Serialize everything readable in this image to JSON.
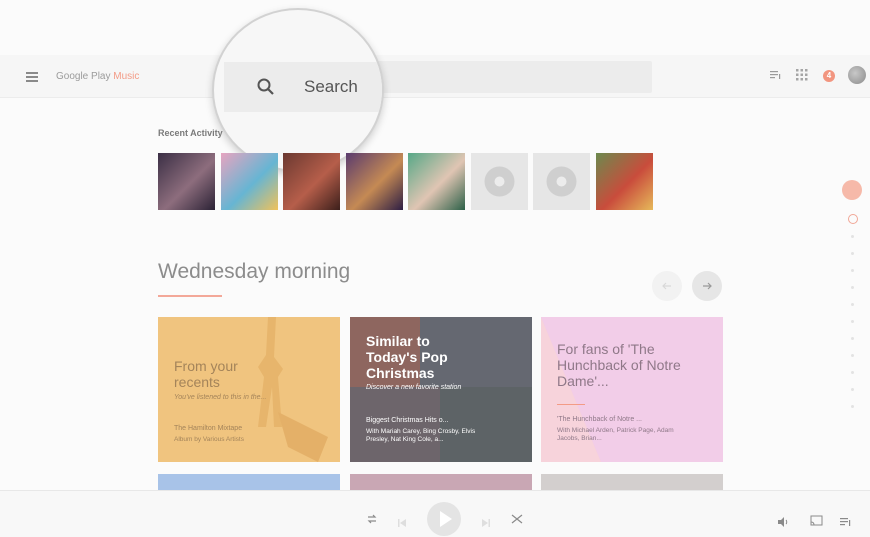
{
  "app": {
    "logo_prefix": "Google Play ",
    "logo_music": "Music"
  },
  "search": {
    "label": "Search"
  },
  "header": {
    "notifications_count": "4"
  },
  "recent": {
    "label": "Recent Activity",
    "albums": [
      {
        "name": "album-1",
        "colors": [
          "#3b2f45",
          "#8d6d7d",
          "#2b2235"
        ]
      },
      {
        "name": "album-2",
        "colors": [
          "#e7a4c0",
          "#66b5d3",
          "#f0c25a"
        ]
      },
      {
        "name": "album-3",
        "colors": [
          "#6b3931",
          "#b65e4a",
          "#3c1f1b"
        ]
      },
      {
        "name": "album-4",
        "colors": [
          "#5a3b6e",
          "#c58a54",
          "#2d1e44"
        ]
      },
      {
        "name": "album-5",
        "colors": [
          "#57a887",
          "#e0c5b3",
          "#2c6048"
        ]
      },
      {
        "name": "album-6",
        "colors": [
          "#e6e6e6",
          "#cfcfcf",
          "#ededed"
        ]
      },
      {
        "name": "album-7",
        "colors": [
          "#e6e6e6",
          "#cfcfcf",
          "#ededed"
        ]
      },
      {
        "name": "album-8",
        "colors": [
          "#6c8a4e",
          "#c94c3c",
          "#e6b95a"
        ]
      }
    ]
  },
  "section": {
    "title": "Wednesday morning"
  },
  "cards": [
    {
      "title": "From your recents",
      "subtitle": "You've listened to this in the...",
      "album_title": "The Hamilton Mixtape",
      "album_sub": "Album by Various Artists",
      "bg": "#f0c47f",
      "text_color": "#a4845a"
    },
    {
      "title": "Similar to Today's Pop Christmas",
      "subtitle": "Discover a new favorite station",
      "album_title": "Biggest Christmas Hits o...",
      "album_sub": "With Mariah Carey, Bing Crosby, Elvis Presley, Nat King Cole, a...",
      "bg": "#8d8d8d",
      "text_color": "#ffffff"
    },
    {
      "title": "For fans of 'The Hunchback of Notre Dame'...",
      "subtitle": "",
      "album_title": "'The Hunchback of Notre ...",
      "album_sub": "With Michael Arden, Patrick Page, Adam Jacobs, Brian...",
      "bg": "#f1c3e5",
      "text_color": "#8f7888"
    }
  ],
  "player": {
    "labels": []
  },
  "colors": {
    "accent": "#f39b86",
    "brand_orange": "#ef8c6a"
  }
}
